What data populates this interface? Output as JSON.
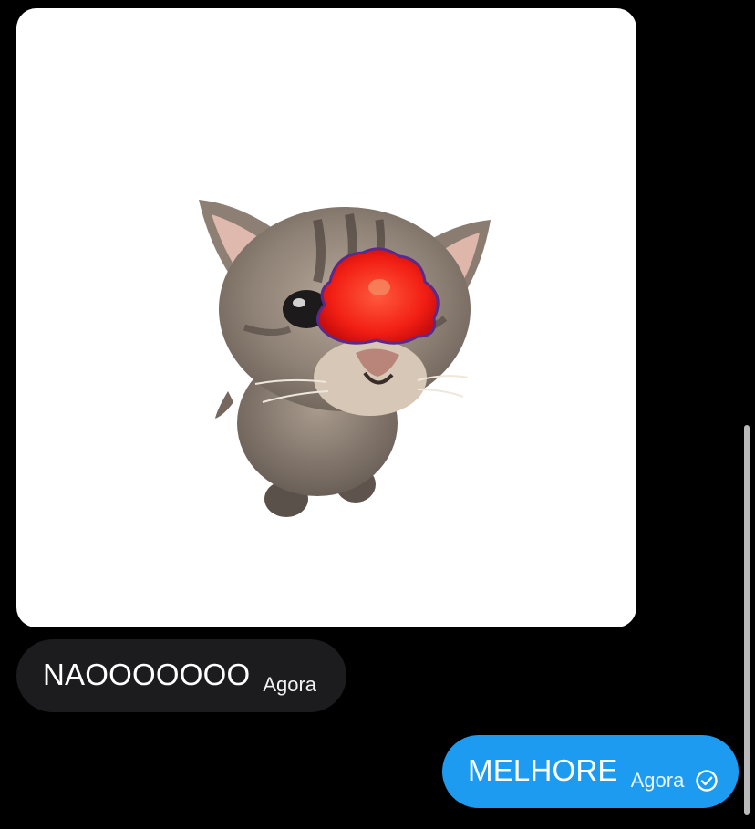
{
  "chat": {
    "messages": [
      {
        "kind": "image",
        "direction": "incoming",
        "image_subject": "kitten-with-red-splat"
      },
      {
        "kind": "text",
        "direction": "incoming",
        "text": "NAOOOOOOO",
        "time": "Agora"
      },
      {
        "kind": "text",
        "direction": "outgoing",
        "text": "MELHORE",
        "time": "Agora",
        "status_icon": "read-check-circle-icon"
      }
    ]
  },
  "colors": {
    "background": "#000000",
    "incoming_bubble": "#1c1c1e",
    "outgoing_bubble": "#1d9bf0",
    "scrollbar": "#b9b9b9"
  }
}
